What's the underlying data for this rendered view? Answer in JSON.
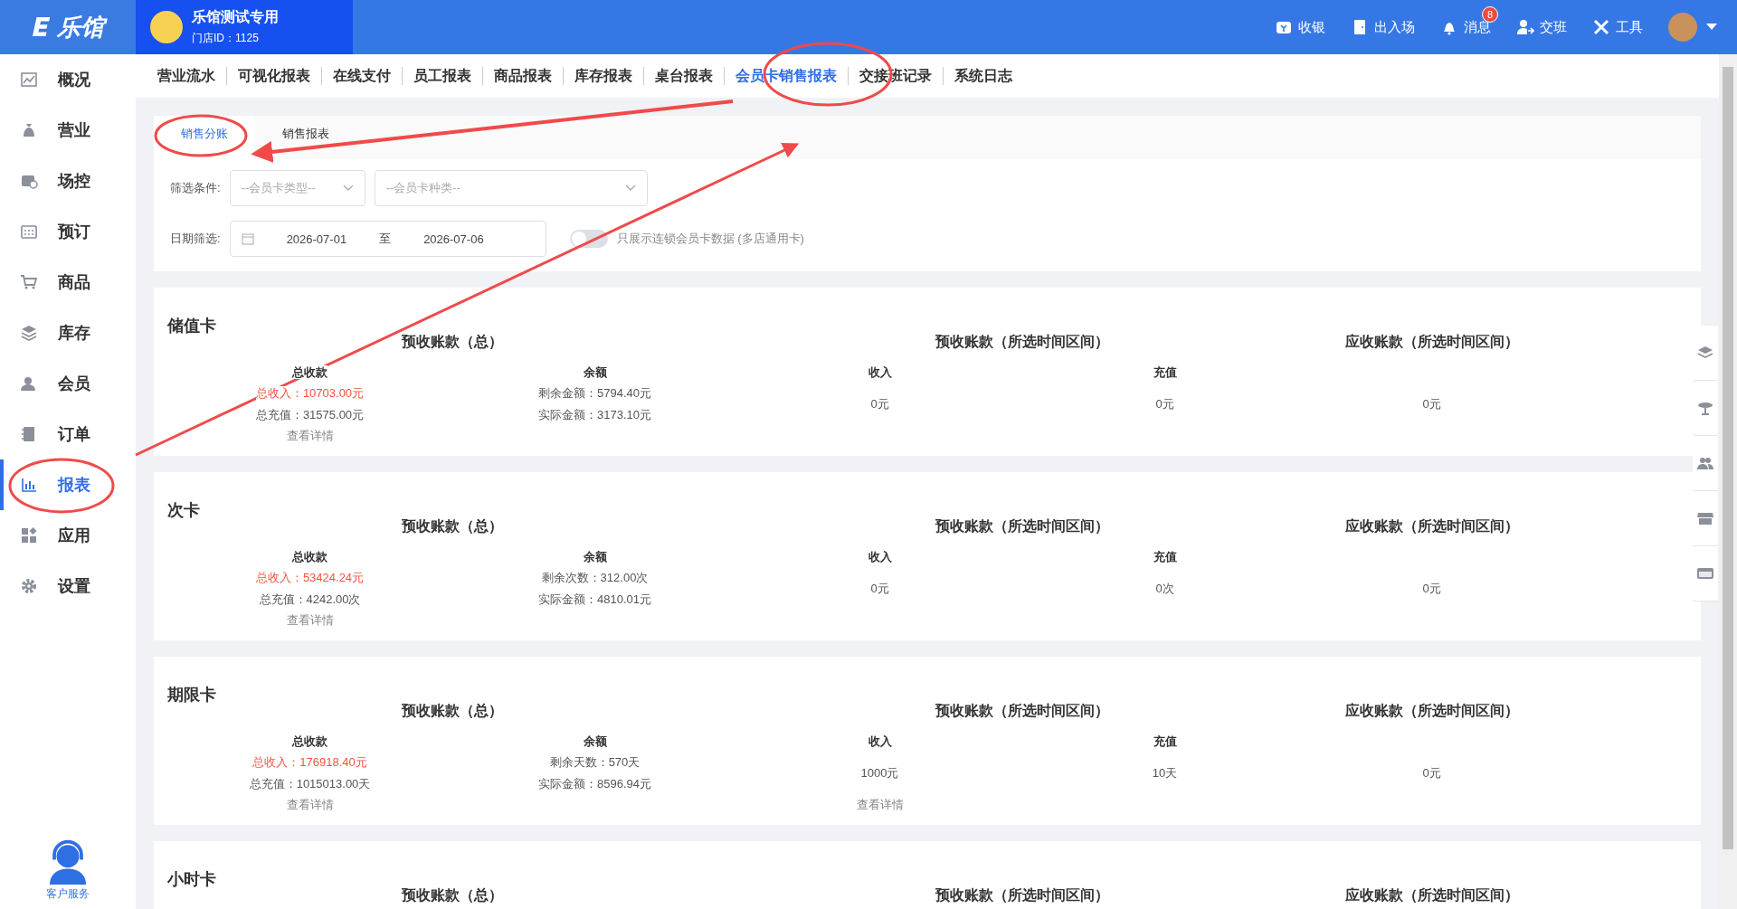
{
  "brand": {
    "logo": "乐馆"
  },
  "store": {
    "name": "乐馆测试专用",
    "id_label": "门店ID：1125"
  },
  "top_actions": [
    {
      "kind": "cashier",
      "label": "收银"
    },
    {
      "kind": "door",
      "label": "出入场"
    },
    {
      "kind": "bell",
      "label": "消息",
      "badge": "8"
    },
    {
      "kind": "shift",
      "label": "交班"
    },
    {
      "kind": "tools",
      "label": "工具"
    }
  ],
  "sidebar": {
    "items": [
      {
        "kind": "chart",
        "label": "概况",
        "selected": false
      },
      {
        "kind": "bag",
        "label": "营业",
        "selected": false
      },
      {
        "kind": "venue",
        "label": "场控",
        "selected": false
      },
      {
        "kind": "calendar",
        "label": "预订",
        "selected": false
      },
      {
        "kind": "cart",
        "label": "商品",
        "selected": false
      },
      {
        "kind": "layers",
        "label": "库存",
        "selected": false
      },
      {
        "kind": "user",
        "label": "会员",
        "selected": false
      },
      {
        "kind": "order",
        "label": "订单",
        "selected": false
      },
      {
        "kind": "bars",
        "label": "报表",
        "selected": true
      },
      {
        "kind": "apps",
        "label": "应用",
        "selected": false
      },
      {
        "kind": "gear",
        "label": "设置",
        "selected": false
      }
    ],
    "support": "客户服务"
  },
  "tabs": [
    {
      "label": "营业流水",
      "selected": false
    },
    {
      "label": "可视化报表",
      "selected": false
    },
    {
      "label": "在线支付",
      "selected": false
    },
    {
      "label": "员工报表",
      "selected": false
    },
    {
      "label": "商品报表",
      "selected": false
    },
    {
      "label": "库存报表",
      "selected": false
    },
    {
      "label": "桌台报表",
      "selected": false
    },
    {
      "label": "会员卡销售报表",
      "selected": true
    },
    {
      "label": "交接班记录",
      "selected": false
    },
    {
      "label": "系统日志",
      "selected": false
    }
  ],
  "subtabs": [
    {
      "label": "销售分账",
      "selected": true
    },
    {
      "label": "销售报表",
      "selected": false
    }
  ],
  "filters": {
    "condition_label": "筛选条件:",
    "card_type": {
      "placeholder": "--会员卡类型--"
    },
    "card_kind": {
      "placeholder": "--会员卡种类--"
    },
    "date_label": "日期筛选:",
    "date_start": "2026-07-01",
    "date_sep": "至",
    "date_end": "2026-07-06",
    "chain_only": {
      "on": false,
      "label": "只展示连锁会员卡数据 (多店通用卡)"
    }
  },
  "sections": [
    {
      "title": "储值卡",
      "groups": [
        "预收账款（总）",
        "预收账款（所选时间区间）",
        "应收账款（所选时间区间）"
      ],
      "columns": [
        {
          "header": "总收款",
          "lines": [
            {
              "kind": "highlight",
              "text": "总收入：10703.00元"
            },
            {
              "kind": "plain",
              "text": "总充值：31575.00元"
            }
          ],
          "link": "查看详情"
        },
        {
          "header": "余额",
          "lines": [
            {
              "kind": "plain",
              "text": "剩余金额：5794.40元"
            },
            {
              "kind": "plain",
              "text": "实际金额：3173.10元"
            }
          ]
        },
        {
          "header": "收入",
          "lines": [
            {
              "kind": "plain",
              "text": "0元"
            }
          ]
        },
        {
          "header": "充值",
          "lines": [
            {
              "kind": "plain",
              "text": "0元"
            }
          ]
        },
        {
          "lines": [
            {
              "kind": "plain",
              "text": "0元"
            }
          ]
        }
      ]
    },
    {
      "title": "次卡",
      "groups": [
        "预收账款（总）",
        "预收账款（所选时间区间）",
        "应收账款（所选时间区间）"
      ],
      "columns": [
        {
          "header": "总收款",
          "lines": [
            {
              "kind": "highlight",
              "text": "总收入：53424.24元"
            },
            {
              "kind": "plain",
              "text": "总充值：4242.00次"
            }
          ],
          "link": "查看详情"
        },
        {
          "header": "余额",
          "lines": [
            {
              "kind": "plain",
              "text": "剩余次数：312.00次"
            },
            {
              "kind": "plain",
              "text": "实际金额：4810.01元"
            }
          ]
        },
        {
          "header": "收入",
          "lines": [
            {
              "kind": "plain",
              "text": "0元"
            }
          ]
        },
        {
          "header": "充值",
          "lines": [
            {
              "kind": "plain",
              "text": "0次"
            }
          ]
        },
        {
          "lines": [
            {
              "kind": "plain",
              "text": "0元"
            }
          ]
        }
      ]
    },
    {
      "title": "期限卡",
      "groups": [
        "预收账款（总）",
        "预收账款（所选时间区间）",
        "应收账款（所选时间区间）"
      ],
      "columns": [
        {
          "header": "总收款",
          "lines": [
            {
              "kind": "highlight",
              "text": "总收入：176918.40元"
            },
            {
              "kind": "plain",
              "text": "总充值：1015013.00天"
            }
          ],
          "link": "查看详情"
        },
        {
          "header": "余额",
          "lines": [
            {
              "kind": "plain",
              "text": "剩余天数：570天"
            },
            {
              "kind": "plain",
              "text": "实际金额：8596.94元"
            }
          ]
        },
        {
          "header": "收入",
          "lines": [
            {
              "kind": "plain",
              "text": "1000元"
            }
          ],
          "link": "查看详情"
        },
        {
          "header": "充值",
          "lines": [
            {
              "kind": "plain",
              "text": "10天"
            }
          ]
        },
        {
          "lines": [
            {
              "kind": "plain",
              "text": "0元"
            }
          ]
        }
      ]
    },
    {
      "title": "小时卡",
      "groups": [
        "预收账款（总）",
        "预收账款（所选时间区间）",
        "应收账款（所选时间区间）"
      ]
    }
  ],
  "side_tools": [
    {
      "kind": "layers"
    },
    {
      "kind": "table"
    },
    {
      "kind": "users"
    },
    {
      "kind": "shop"
    },
    {
      "kind": "card"
    }
  ]
}
